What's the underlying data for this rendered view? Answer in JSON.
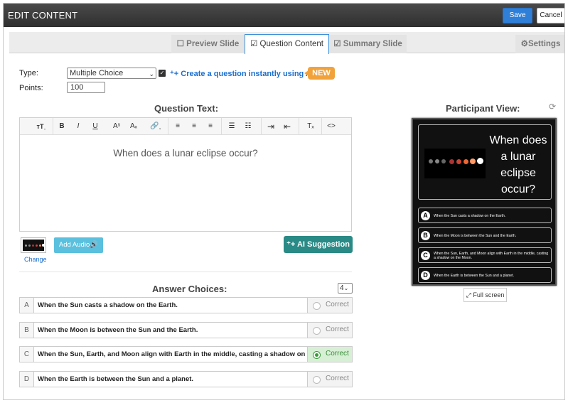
{
  "header": {
    "title": "EDIT CONTENT",
    "save_label": "Save",
    "cancel_label": "Cancel"
  },
  "tabs": {
    "preview": "Preview Slide",
    "question": "Question Content",
    "summary": "Summary Slide",
    "settings": "Settings"
  },
  "form": {
    "type_label": "Type:",
    "type_value": "Multiple Choice",
    "points_label": "Points:",
    "points_value": "100",
    "ai_link": "Create a question instantly using AI.",
    "new_badge": "NEW"
  },
  "editor": {
    "title": "Question Text:",
    "text": "When does a lunar eclipse occur?",
    "toolbar": [
      "TT",
      "B",
      "I",
      "U",
      "A",
      "A",
      "link",
      "align-left",
      "align-center",
      "align-right",
      "bullet-list",
      "numbered-list",
      "indent",
      "outdent",
      "clear-format",
      "code"
    ]
  },
  "media": {
    "change_label": "Change",
    "add_audio_label": "Add Audio",
    "ai_suggestion_label": "AI Suggestion"
  },
  "answers": {
    "title": "Answer Choices:",
    "count": "4",
    "correct_label": "Correct",
    "items": [
      {
        "letter": "A",
        "text": "When the Sun casts a shadow on the Earth.",
        "correct": false
      },
      {
        "letter": "B",
        "text": "When the Moon is between the Sun and the Earth.",
        "correct": false
      },
      {
        "letter": "C",
        "text": "When the Sun, Earth, and Moon align with Earth in the middle, casting a shadow on the Moon.",
        "correct": true
      },
      {
        "letter": "D",
        "text": "When the Earth is between the Sun and a planet.",
        "correct": false
      }
    ]
  },
  "participant_view": {
    "title": "Participant View:",
    "question_text": "When does a lunar eclipse occur?",
    "full_screen_label": "Full screen",
    "answers": [
      {
        "letter": "A",
        "text": "When the Sun casts a shadow on the Earth."
      },
      {
        "letter": "B",
        "text": "When the Moon is between the Sun and the Earth."
      },
      {
        "letter": "C",
        "text": "When the Sun, Earth, and Moon align with Earth in the middle, casting a shadow on the Moon."
      },
      {
        "letter": "D",
        "text": "When the Earth is between the Sun and a planet."
      }
    ]
  },
  "colors": {
    "save_button": "#2f7fd8",
    "new_badge": "#f2a23a",
    "audio_button": "#5bc0de",
    "ai_suggestion_button": "#2a8a86",
    "correct_selected": "#d7f0d5"
  }
}
